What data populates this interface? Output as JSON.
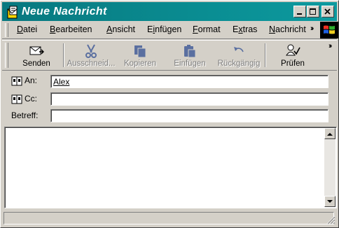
{
  "window": {
    "title": "Neue Nachricht"
  },
  "menu": {
    "items": [
      {
        "pre": "",
        "u": "D",
        "post": "atei"
      },
      {
        "pre": "",
        "u": "B",
        "post": "earbeiten"
      },
      {
        "pre": "",
        "u": "A",
        "post": "nsicht"
      },
      {
        "pre": "E",
        "u": "i",
        "post": "nfügen"
      },
      {
        "pre": "",
        "u": "F",
        "post": "ormat"
      },
      {
        "pre": "E",
        "u": "x",
        "post": "tras"
      },
      {
        "pre": "",
        "u": "N",
        "post": "achricht"
      }
    ]
  },
  "toolbar": {
    "send": "Senden",
    "cut": "Ausschneid...",
    "copy": "Kopieren",
    "paste": "Einfügen",
    "undo": "Rückgängig",
    "check": "Prüfen"
  },
  "headers": {
    "to_label": "An:",
    "to_value": "Alex",
    "cc_label": "Cc:",
    "cc_value": "",
    "subject_label": "Betreff:",
    "subject_value": ""
  },
  "colors": {
    "title_bar": "#08787f",
    "face": "#d4d0c8"
  },
  "icons": [
    "envelope-icon",
    "scissors-icon",
    "copy-icon",
    "paste-icon",
    "undo-icon",
    "spellcheck-icon",
    "address-book-icon",
    "windows-logo-icon"
  ]
}
